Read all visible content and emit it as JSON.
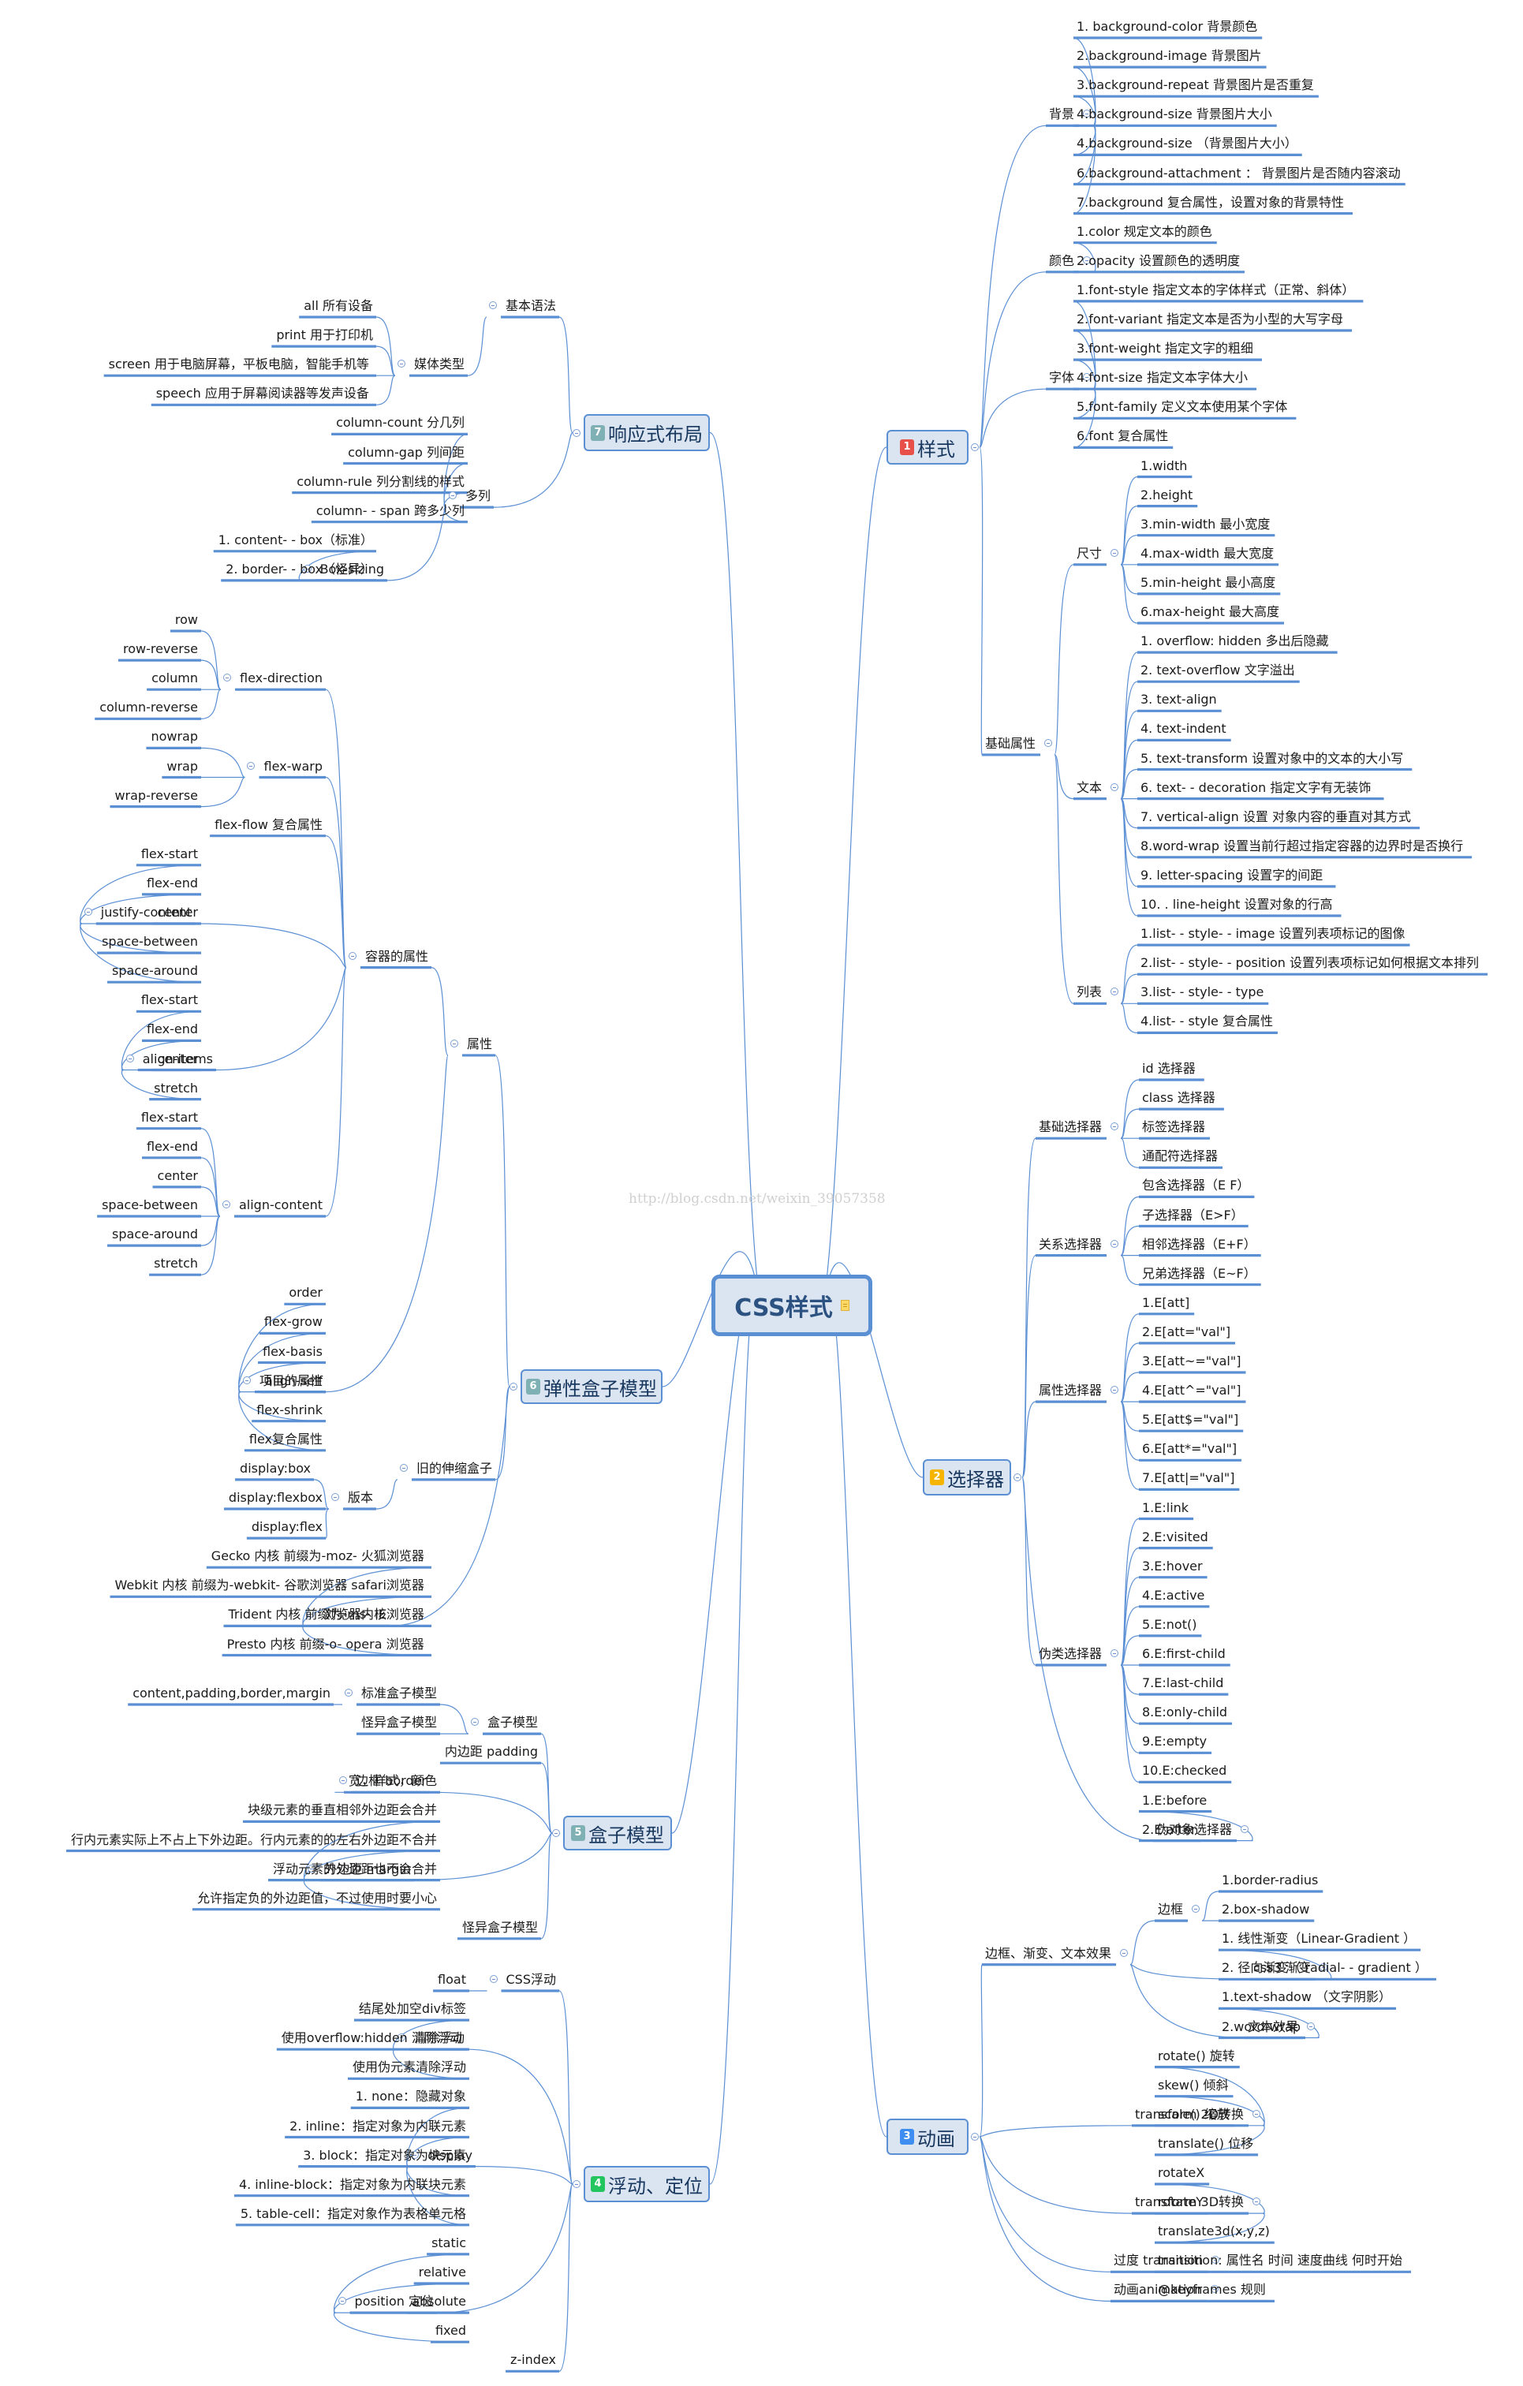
{
  "root": {
    "label": "CSS样式",
    "icon": "note-icon"
  },
  "watermark": "http://blog.csdn.net/weixin_39057358",
  "colors": {
    "line": "#5b8fd4",
    "topic_fill": "#dbe5f1",
    "badge_1": "#e8504a",
    "badge_2": "#f5b400",
    "badge_3": "#3d8ef0",
    "badge_4": "#22c55e",
    "badge_5": "#7fb0b3",
    "badge_6": "#7fb0b3",
    "badge_7": "#7fb0b3"
  },
  "branches": [
    {
      "id": "style",
      "badge": "1",
      "label": "样式",
      "children": [
        {
          "label": "背景",
          "children": [
            {
              "label": "1. background-color 背景颜色"
            },
            {
              "label": "2.background-image 背景图片"
            },
            {
              "label": "3.background-repeat 背景图片是否重复"
            },
            {
              "label": "4.background-size 背景图片大小"
            },
            {
              "label": "4.background-size （背景图片大小）"
            },
            {
              "label": "6.background-attachment ： 背景图片是否随内容滚动"
            },
            {
              "label": "7.background  复合属性，设置对象的背景特性"
            }
          ]
        },
        {
          "label": "颜色",
          "children": [
            {
              "label": "1.color 规定文本的颜色"
            },
            {
              "label": "2.opacity 设置颜色的透明度"
            }
          ]
        },
        {
          "label": "字体",
          "children": [
            {
              "label": "1.font-style  指定文本的字体样式（正常、斜体）"
            },
            {
              "label": "2.font-variant  指定文本是否为小型的大写字母"
            },
            {
              "label": "3.font-weight  指定文字的粗细"
            },
            {
              "label": "4.font-size  指定文本字体大小"
            },
            {
              "label": "5.font-family  定义文本使用某个字体"
            },
            {
              "label": "6.font 复合属性"
            }
          ]
        },
        {
          "label": "基础属性",
          "children": [
            {
              "label": "尺寸",
              "children": [
                {
                  "label": "1.width"
                },
                {
                  "label": "2.height"
                },
                {
                  "label": "3.min-width 最小宽度"
                },
                {
                  "label": "4.max-width 最大宽度"
                },
                {
                  "label": "5.min-height 最小高度"
                },
                {
                  "label": "6.max-height 最大高度"
                }
              ]
            },
            {
              "label": "文本",
              "children": [
                {
                  "label": "1. overflow: hidden  多出后隐藏"
                },
                {
                  "label": "2. text-overflow 文字溢出"
                },
                {
                  "label": "3. text-align"
                },
                {
                  "label": "4. text-indent"
                },
                {
                  "label": "5. text-transform  设置对象中的文本的大小写"
                },
                {
                  "label": "6.  text- - decoration  指定文字有无装饰"
                },
                {
                  "label": "7. vertical-align  设置 对象内容的垂直对其方式"
                },
                {
                  "label": "8.word-wrap  设置当前行超过指定容器的边界时是否换行"
                },
                {
                  "label": "9.  letter-spacing  设置字的间距"
                },
                {
                  "label": "10. . line-height  设置对象的行高"
                }
              ]
            },
            {
              "label": "列表",
              "children": [
                {
                  "label": "1.list- - style- - image 设置列表项标记的图像"
                },
                {
                  "label": "2.list- - style- - position  设置列表项标记如何根据文本排列"
                },
                {
                  "label": "3.list- - style- - type"
                },
                {
                  "label": "4.list- - style 复合属性"
                }
              ]
            }
          ]
        }
      ]
    },
    {
      "id": "selector",
      "badge": "2",
      "label": "选择器",
      "children": [
        {
          "label": "基础选择器",
          "children": [
            {
              "label": "id  选择器"
            },
            {
              "label": "class  选择器"
            },
            {
              "label": "标签选择器"
            },
            {
              "label": "通配符选择器"
            }
          ]
        },
        {
          "label": "关系选择器",
          "children": [
            {
              "label": "包含选择器（E F）"
            },
            {
              "label": "子选择器（E>F）"
            },
            {
              "label": "相邻选择器（E+F）"
            },
            {
              "label": "兄弟选择器（E~F）"
            }
          ]
        },
        {
          "label": "属性选择器",
          "children": [
            {
              "label": "1.E[att]"
            },
            {
              "label": "2.E[att=\"val\"]"
            },
            {
              "label": "3.E[att~=\"val\"]"
            },
            {
              "label": "4.E[att^=\"val\"]"
            },
            {
              "label": "5.E[att$=\"val\"]"
            },
            {
              "label": "6.E[att*=\"val\"]"
            },
            {
              "label": "7.E[att|=\"val\"]"
            }
          ]
        },
        {
          "label": "伪类选择器",
          "children": [
            {
              "label": "1.E:link"
            },
            {
              "label": "2.E:visited"
            },
            {
              "label": "3.E:hover"
            },
            {
              "label": "4.E:active"
            },
            {
              "label": "5.E:not()"
            },
            {
              "label": "6.E:first-child"
            },
            {
              "label": "7.E:last-child"
            },
            {
              "label": "8.E:only-child"
            },
            {
              "label": "9.E:empty"
            },
            {
              "label": "10.E:checked"
            }
          ]
        },
        {
          "label": "伪对象选择器",
          "children": [
            {
              "label": "1.E:before"
            },
            {
              "label": "2.E:after"
            }
          ]
        }
      ]
    },
    {
      "id": "animation",
      "badge": "3",
      "label": "动画",
      "children": [
        {
          "label": "边框、渐变、文本效果",
          "children": [
            {
              "label": "边框",
              "children": [
                {
                  "label": "1.border-radius"
                },
                {
                  "label": "2.box-shadow"
                }
              ]
            },
            {
              "label": "css3 渐变",
              "children": [
                {
                  "label": "1. 线性渐变（Linear-Gradient ）"
                },
                {
                  "label": "2. 径向渐变（  radial- - gradient ）"
                }
              ]
            },
            {
              "label": "文本效果",
              "children": [
                {
                  "label": "1.text-shadow （文字阴影）"
                },
                {
                  "label": "2.word-wrap"
                }
              ]
            }
          ]
        },
        {
          "label": "transform 2D转换",
          "children": [
            {
              "label": "rotate() 旋转"
            },
            {
              "label": "skew() 倾斜"
            },
            {
              "label": "scale() 缩放"
            },
            {
              "label": "translate() 位移"
            }
          ]
        },
        {
          "label": "transform 3D转换",
          "children": [
            {
              "label": "rotateX"
            },
            {
              "label": "rotateY"
            },
            {
              "label": "translate3d(x,y,z)"
            }
          ]
        },
        {
          "label": "过度 transition",
          "children": [
            {
              "label": "transition:  属性名 时间 速度曲线 何时开始"
            }
          ]
        },
        {
          "label": "动画animation",
          "children": [
            {
              "label": "@keyframes  规则"
            }
          ]
        }
      ]
    },
    {
      "id": "responsive",
      "badge": "7",
      "label": "响应式布局",
      "children": [
        {
          "label": "基本语法",
          "children": [
            {
              "label": "媒体类型",
              "children": [
                {
                  "label": "all 所有设备"
                },
                {
                  "label": "print 用于打印机"
                },
                {
                  "label": "screen  用于电脑屏幕，平板电脑，智能手机等"
                },
                {
                  "label": "speech  应用于屏幕阅读器等发声设备"
                }
              ]
            }
          ]
        },
        {
          "label": "多列",
          "children": [
            {
              "label": "column-count 分几列"
            },
            {
              "label": "column-gap 列间距"
            },
            {
              "label": "column-rule 列分割线的样式"
            },
            {
              "label": "column- - span 跨多少列"
            },
            {
              "label": "Box-sizing",
              "children": [
                {
                  "label": "1. content- - box（标准）"
                },
                {
                  "label": "2. border- - box（怪异）"
                }
              ]
            }
          ]
        }
      ]
    },
    {
      "id": "flexbox",
      "badge": "6",
      "label": "弹性盒子模型",
      "children": [
        {
          "label": "属性",
          "children": [
            {
              "label": "容器的属性",
              "children": [
                {
                  "label": "flex-direction",
                  "children": [
                    {
                      "label": "row"
                    },
                    {
                      "label": "row-reverse"
                    },
                    {
                      "label": "column"
                    },
                    {
                      "label": "column-reverse"
                    }
                  ]
                },
                {
                  "label": "flex-warp",
                  "children": [
                    {
                      "label": "nowrap"
                    },
                    {
                      "label": "wrap"
                    },
                    {
                      "label": "wrap-reverse"
                    }
                  ]
                },
                {
                  "label": "flex-flow 复合属性"
                },
                {
                  "label": "justify-content",
                  "children": [
                    {
                      "label": "flex-start"
                    },
                    {
                      "label": "flex-end"
                    },
                    {
                      "label": "center"
                    },
                    {
                      "label": "space-between"
                    },
                    {
                      "label": "space-around"
                    }
                  ]
                },
                {
                  "label": "align-items",
                  "children": [
                    {
                      "label": "flex-start"
                    },
                    {
                      "label": "flex-end"
                    },
                    {
                      "label": "center"
                    },
                    {
                      "label": "stretch"
                    }
                  ]
                },
                {
                  "label": "align-content",
                  "children": [
                    {
                      "label": "flex-start"
                    },
                    {
                      "label": "flex-end"
                    },
                    {
                      "label": "center"
                    },
                    {
                      "label": "space-between"
                    },
                    {
                      "label": "space-around"
                    },
                    {
                      "label": "stretch"
                    }
                  ]
                }
              ]
            },
            {
              "label": "项目的属性",
              "children": [
                {
                  "label": "order"
                },
                {
                  "label": "flex-grow"
                },
                {
                  "label": "flex-basis"
                },
                {
                  "label": "align-self"
                },
                {
                  "label": "flex-shrink"
                },
                {
                  "label": "flex复合属性"
                }
              ]
            }
          ]
        },
        {
          "label": "旧的伸缩盒子",
          "children": [
            {
              "label": "版本",
              "children": [
                {
                  "label": "display:box"
                },
                {
                  "label": "display:flexbox"
                },
                {
                  "label": "display:flex"
                }
              ]
            }
          ]
        },
        {
          "label": "浏览器内核",
          "children": [
            {
              "label": "Gecko  内核 前缀为-moz- 火狐浏览器"
            },
            {
              "label": "Webkit  内核 前缀为-webkit- 谷歌浏览器 safari浏览器"
            },
            {
              "label": "Trident  内核 前缀为-ms- IE浏览器"
            },
            {
              "label": "Presto  内核 前缀-o- opera 浏览器"
            }
          ]
        }
      ]
    },
    {
      "id": "boxmodel",
      "badge": "5",
      "label": "盒子模型",
      "children": [
        {
          "label": "盒子模型",
          "children": [
            {
              "label": "标准盒子模型",
              "children": [
                {
                  "label": "content,padding,border,margin"
                }
              ]
            },
            {
              "label": "怪异盒子模型"
            }
          ]
        },
        {
          "label": "内边距 padding"
        },
        {
          "label": "边框 border",
          "children": [
            {
              "label": "宽，样式，颜色"
            }
          ]
        },
        {
          "label": "外边距 margin",
          "children": [
            {
              "label": "块级元素的垂直相邻外边距会合并"
            },
            {
              "label": "行内元素实际上不占上下外边距。行内元素的的左右外边距不合并"
            },
            {
              "label": "浮动元素的外边距也不会合并"
            },
            {
              "label": "允许指定负的外边距值，不过使用时要小心"
            }
          ]
        },
        {
          "label": "怪异盒子模型"
        }
      ]
    },
    {
      "id": "float",
      "badge": "4",
      "label": "浮动、定位",
      "children": [
        {
          "label": "CSS浮动",
          "children": [
            {
              "label": "float"
            }
          ]
        },
        {
          "label": "清除浮动",
          "children": [
            {
              "label": "结尾处加空div标签"
            },
            {
              "label": "使用overflow:hidden  清除浮动"
            },
            {
              "label": "使用伪元素清除浮动"
            }
          ]
        },
        {
          "label": "display",
          "children": [
            {
              "label": "1. none：隐藏对象"
            },
            {
              "label": "2. inline：指定对象为内联元素"
            },
            {
              "label": "3. block：指定对象为块元素"
            },
            {
              "label": "4. inline-block：指定对象为内联块元素"
            },
            {
              "label": "5. table-cell：指定对象作为表格单元格"
            }
          ]
        },
        {
          "label": "position 定位",
          "children": [
            {
              "label": "static"
            },
            {
              "label": "relative"
            },
            {
              "label": "absolute"
            },
            {
              "label": "fixed"
            }
          ]
        },
        {
          "label": "z-index"
        }
      ]
    }
  ]
}
